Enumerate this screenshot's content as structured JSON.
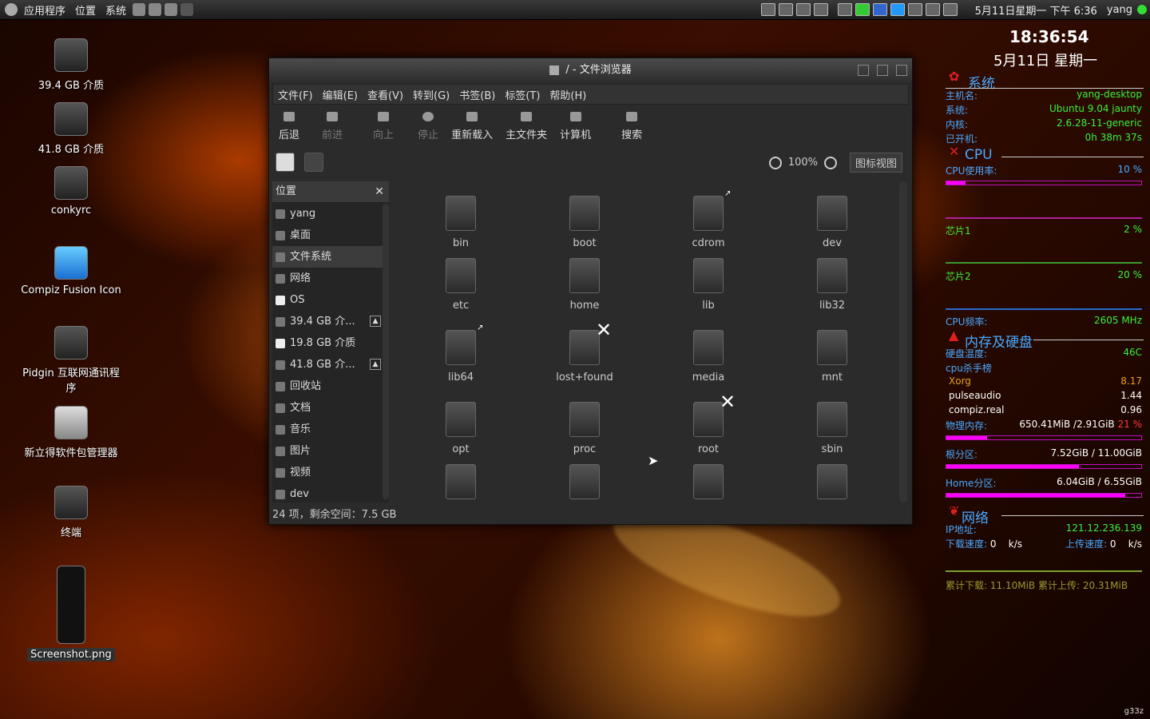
{
  "panel": {
    "apps": "应用程序",
    "places": "位置",
    "system": "系统",
    "datetime": "5月11日星期一 下午 6:36",
    "user": "yang"
  },
  "desktop": [
    {
      "label": "39.4 GB 介质"
    },
    {
      "label": "41.8 GB 介质"
    },
    {
      "label": "conkyrc"
    },
    {
      "label": "Compiz Fusion Icon"
    },
    {
      "label": "Pidgin 互联网通讯程序"
    },
    {
      "label": "新立得软件包管理器"
    },
    {
      "label": "终端"
    },
    {
      "label": "Screenshot.png"
    }
  ],
  "window": {
    "title": "/ - 文件浏览器",
    "menu": [
      "文件(F)",
      "编辑(E)",
      "查看(V)",
      "转到(G)",
      "书签(B)",
      "标签(T)",
      "帮助(H)"
    ],
    "toolbar": [
      "后退",
      "前进",
      "向上",
      "停止",
      "重新载入",
      "主文件夹",
      "计算机",
      "搜索"
    ],
    "zoom": "100%",
    "view_mode": "图标视图",
    "sidebar_title": "位置",
    "sidebar": [
      "yang",
      "桌面",
      "文件系统",
      "网络",
      "OS",
      "39.4 GB 介...",
      "19.8 GB 介质",
      "41.8 GB 介...",
      "回收站",
      "文档",
      "音乐",
      "图片",
      "视频",
      "dev"
    ],
    "folders": [
      "bin",
      "boot",
      "cdrom",
      "dev",
      "etc",
      "home",
      "lib",
      "lib32",
      "lib64",
      "lost+found",
      "media",
      "mnt",
      "opt",
      "proc",
      "root",
      "sbin"
    ],
    "status": "24 项，剩余空间：7.5 GB"
  },
  "conky": {
    "time": "18:36:54",
    "date": "5月11日 星期一",
    "sec_system": "系统",
    "hostname_label": "主机名:",
    "hostname": "yang-desktop",
    "os_label": "系统:",
    "os": "Ubuntu 9.04 jaunty",
    "kernel_label": "内核:",
    "kernel": "2.6.28-11-generic",
    "uptime_label": "已开机:",
    "uptime": "0h 38m 37s",
    "sec_cpu": "CPU",
    "cpu_usage_label": "CPU使用率:",
    "cpu_usage": "10 %",
    "cpu_usage_pct": 10,
    "core1_label": "芯片1",
    "core1": "2 %",
    "core2_label": "芯片2",
    "core2": "20 %",
    "freq_label": "CPU频率:",
    "freq": "2605 MHz",
    "sec_mem": "内存及硬盘",
    "disk_temp_label": "硬盘温度:",
    "disk_temp": "46C",
    "top_label": "cpu杀手榜",
    "procs": [
      {
        "name": "Xorg",
        "val": "8.17"
      },
      {
        "name": "pulseaudio",
        "val": "1.44"
      },
      {
        "name": "compiz.real",
        "val": "0.96"
      }
    ],
    "ram_label": "物理内存:",
    "ram": "650.41MiB /2.91GiB",
    "ram_pct_text": "21 %",
    "ram_pct": 21,
    "root_label": "根分区:",
    "root": "7.52GiB / 11.00GiB",
    "root_pct": 68,
    "home_label": "Home分区:",
    "home": "6.04GiB / 6.55GiB",
    "home_pct": 92,
    "sec_net": "网络",
    "ip_label": "IP地址:",
    "ip": "121.12.236.139",
    "down_label": "下载速度:",
    "down": "0",
    "down_unit": "k/s",
    "up_label": "上传速度:",
    "up": "0",
    "up_unit": "k/s",
    "total_down": "累计下载: 11.10MiB",
    "total_up": "累计上传: 20.31MiB"
  },
  "watermark": "g33z"
}
